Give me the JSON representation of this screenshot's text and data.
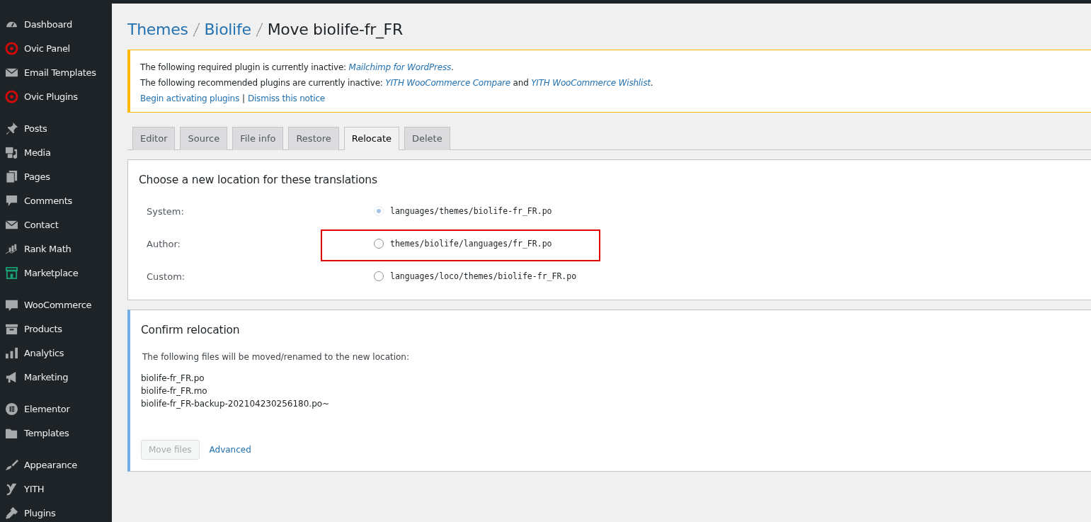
{
  "sidebar": {
    "groups": [
      {
        "items": [
          {
            "label": "Dashboard"
          },
          {
            "label": "Ovic Panel"
          },
          {
            "label": "Email Templates"
          },
          {
            "label": "Ovic Plugins"
          }
        ]
      },
      {
        "items": [
          {
            "label": "Posts"
          },
          {
            "label": "Media"
          },
          {
            "label": "Pages"
          },
          {
            "label": "Comments"
          },
          {
            "label": "Contact"
          },
          {
            "label": "Rank Math"
          },
          {
            "label": "Marketplace"
          }
        ]
      },
      {
        "items": [
          {
            "label": "WooCommerce"
          },
          {
            "label": "Products"
          },
          {
            "label": "Analytics"
          },
          {
            "label": "Marketing"
          }
        ]
      },
      {
        "items": [
          {
            "label": "Elementor"
          },
          {
            "label": "Templates"
          }
        ]
      },
      {
        "items": [
          {
            "label": "Appearance"
          },
          {
            "label": "YITH"
          },
          {
            "label": "Plugins"
          }
        ]
      }
    ]
  },
  "breadcrumb": [
    {
      "label": "Themes",
      "link": true
    },
    {
      "label": "Biolife",
      "link": true
    },
    {
      "label": "Move biolife-fr_FR",
      "link": false
    }
  ],
  "notice": {
    "lines": [
      [
        {
          "text": "The following required plugin is currently inactive: ",
          "kind": "text"
        },
        {
          "text": "Mailchimp for WordPress",
          "kind": "link"
        },
        {
          "text": ".",
          "kind": "text"
        }
      ],
      [
        {
          "text": "The following recommended plugins are currently inactive: ",
          "kind": "text"
        },
        {
          "text": "YITH WooCommerce Compare",
          "kind": "link"
        },
        {
          "text": " and ",
          "kind": "text"
        },
        {
          "text": "YITH WooCommerce Wishlist",
          "kind": "link"
        },
        {
          "text": ".",
          "kind": "text"
        }
      ]
    ],
    "actions": [
      {
        "label": "Begin activating plugins"
      },
      {
        "label": "Dismiss this notice"
      }
    ],
    "separator": "|"
  },
  "tabs": [
    {
      "label": "Editor",
      "selected": false
    },
    {
      "label": "Source",
      "selected": false
    },
    {
      "label": "File info",
      "selected": false
    },
    {
      "label": "Restore",
      "selected": false
    },
    {
      "label": "Relocate",
      "selected": true
    },
    {
      "label": "Delete",
      "selected": false
    }
  ],
  "location_panel": {
    "title": "Choose a new location for these translations",
    "options": [
      {
        "label": "System:",
        "path": "languages/themes/biolife-fr_FR.po",
        "selected": true,
        "highlighted": false
      },
      {
        "label": "Author:",
        "path": "themes/biolife/languages/fr_FR.po",
        "selected": false,
        "highlighted": true
      },
      {
        "label": "Custom:",
        "path": "languages/loco/themes/biolife-fr_FR.po",
        "selected": false,
        "highlighted": false
      }
    ]
  },
  "confirm_panel": {
    "title": "Confirm relocation",
    "description": "The following files will be moved/renamed to the new location:",
    "files": [
      "biolife-fr_FR.po",
      "biolife-fr_FR.mo",
      "biolife-fr_FR-backup-202104230256180.po~"
    ],
    "button": {
      "label": "Move files",
      "disabled": true
    },
    "link": "Advanced"
  }
}
